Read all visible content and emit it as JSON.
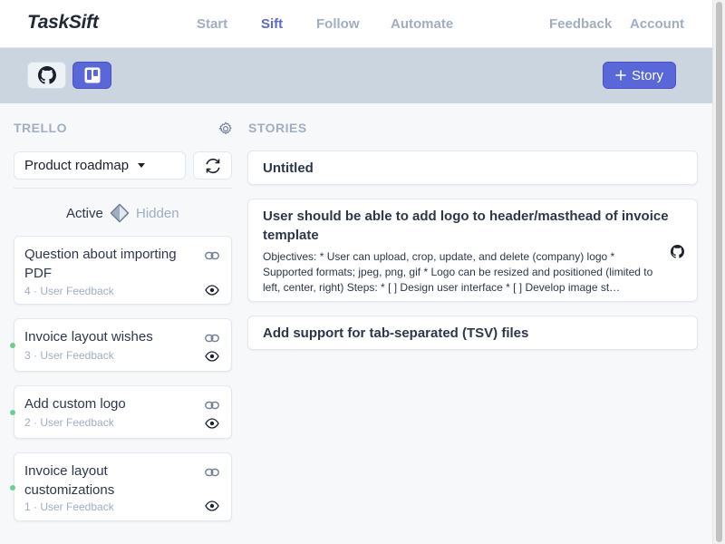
{
  "brand": "TaskSift",
  "nav": {
    "start": "Start",
    "sift": "Sift",
    "follow": "Follow",
    "automate": "Automate",
    "feedback": "Feedback",
    "account": "Account",
    "active_item": "Sift"
  },
  "toolbar": {
    "github_icon": "github-icon",
    "trello_icon": "trello-icon",
    "story_button": "Story",
    "story_icon": "plus-icon"
  },
  "trello": {
    "title": "TRELLO",
    "board_select": "Product roadmap",
    "toggle_active": "Active",
    "toggle_hidden": "Hidden",
    "cards": [
      {
        "title": "Question about importing PDF",
        "meta": "4 · User Feedback",
        "has_dot": false
      },
      {
        "title": "Invoice layout wishes",
        "meta": "3 · User Feedback",
        "has_dot": true
      },
      {
        "title": "Add custom logo",
        "meta": "2 · User Feedback",
        "has_dot": true
      },
      {
        "title": "Invoice layout customizations",
        "meta": "1 · User Feedback",
        "has_dot": true
      }
    ]
  },
  "stories": {
    "title": "STORIES",
    "items": [
      {
        "title": "Untitled"
      },
      {
        "title": "User should be able to add logo to header/masthead of invoice template",
        "description": "Objectives: * User can upload, crop, update, and delete (company) logo * Supported formats; jpeg, png, gif * Logo can be resized and positioned (limited to left, center, right) Steps: * [ ] Design user interface * [ ] Develop image st…"
      },
      {
        "title": "Add support for tab-separated (TSV) files"
      }
    ]
  },
  "colors": {
    "accent": "#5a67d8",
    "toolbar_bg": "#cbd5e0",
    "muted": "#a0aec0",
    "status_dot": "#68d391"
  }
}
